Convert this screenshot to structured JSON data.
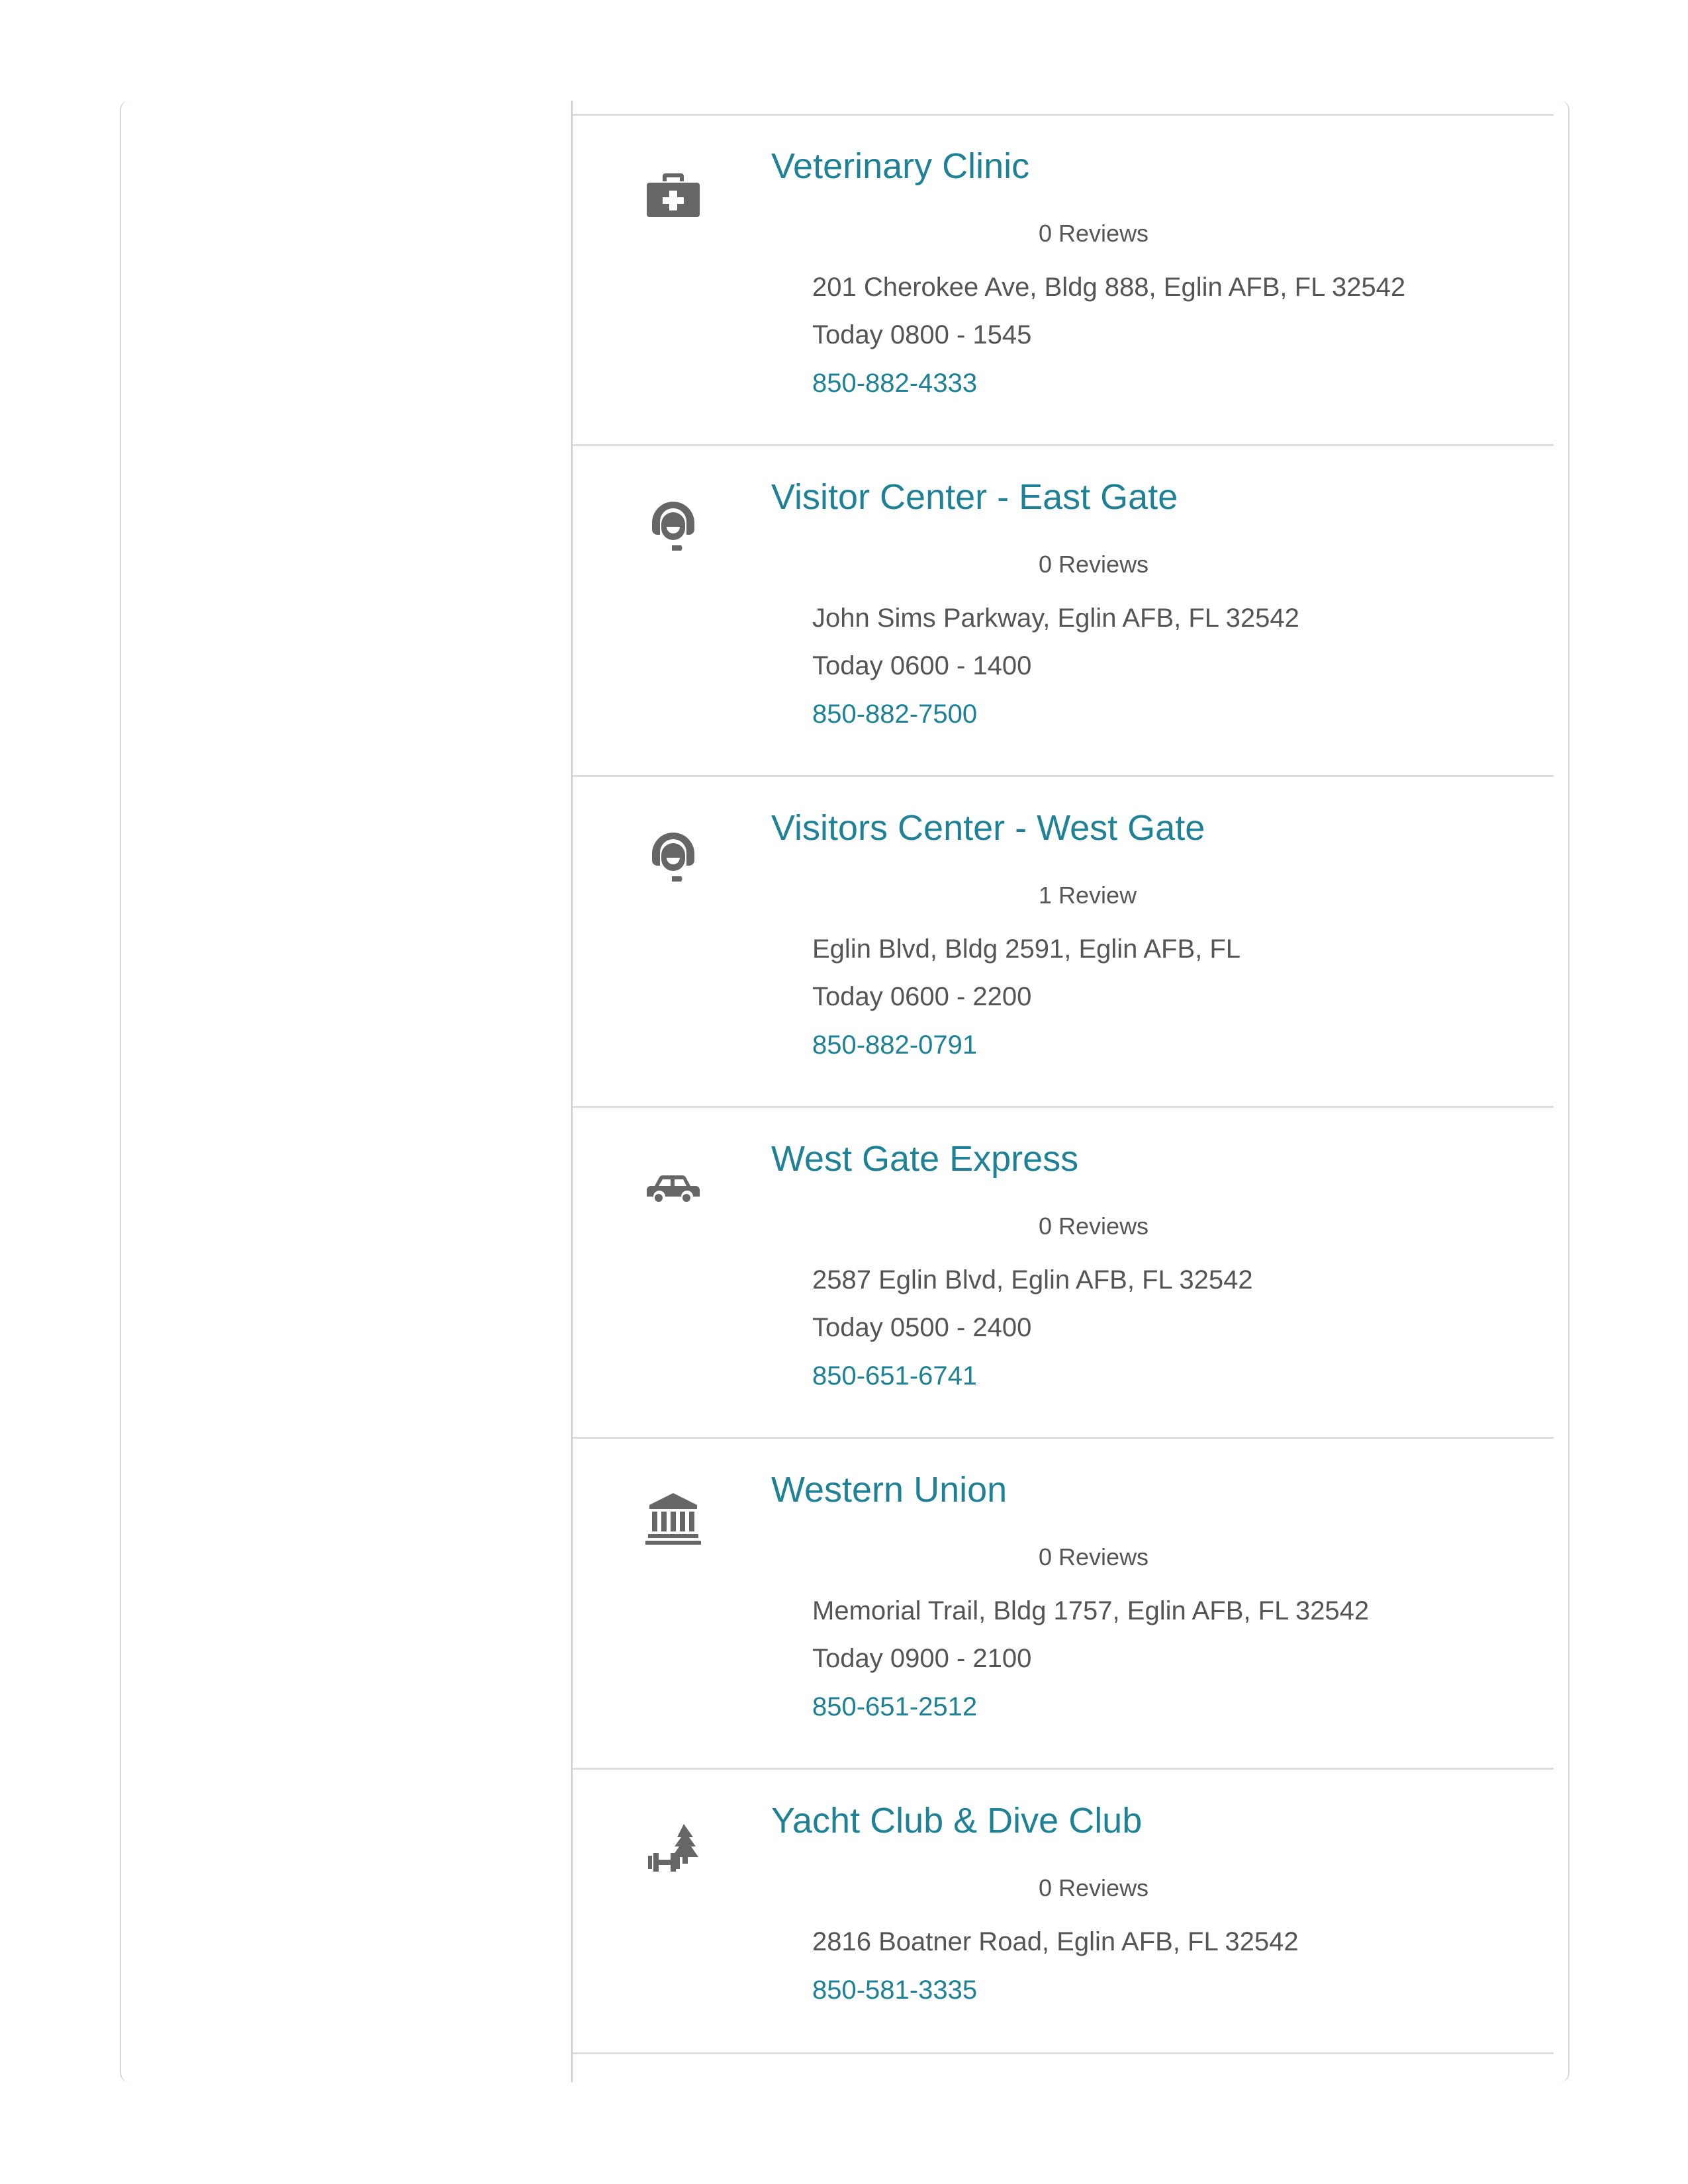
{
  "listings": [
    {
      "title": "Veterinary Clinic",
      "reviews": "0 Reviews",
      "address": "201 Cherokee Ave, Bldg 888, Eglin AFB, FL 32542",
      "hours": "Today 0800 - 1545",
      "phone": "850-882-4333",
      "icon": "medical-kit-icon"
    },
    {
      "title": "Visitor Center - East Gate",
      "reviews": "0 Reviews",
      "address": "John Sims Parkway, Eglin AFB, FL 32542",
      "hours": "Today 0600 - 1400",
      "phone": "850-882-7500",
      "icon": "customer-service-icon"
    },
    {
      "title": "Visitors Center - West Gate",
      "reviews": "1 Review",
      "address": "Eglin Blvd, Bldg 2591, Eglin AFB, FL",
      "hours": "Today 0600 - 2200",
      "phone": "850-882-0791",
      "icon": "customer-service-icon"
    },
    {
      "title": "West Gate Express",
      "reviews": "0 Reviews",
      "address": "2587 Eglin Blvd, Eglin AFB, FL 32542",
      "hours": "Today 0500 - 2400",
      "phone": "850-651-6741",
      "icon": "car-icon"
    },
    {
      "title": "Western Union",
      "reviews": "0 Reviews",
      "address": "Memorial Trail, Bldg 1757, Eglin AFB, FL 32542",
      "hours": "Today 0900 - 2100",
      "phone": "850-651-2512",
      "icon": "bank-icon"
    },
    {
      "title": "Yacht Club & Dive Club",
      "reviews": "0 Reviews",
      "address": "2816 Boatner Road, Eglin AFB, FL 32542",
      "phone": "850-581-3335",
      "icon": "outdoor-fitness-icon"
    }
  ]
}
